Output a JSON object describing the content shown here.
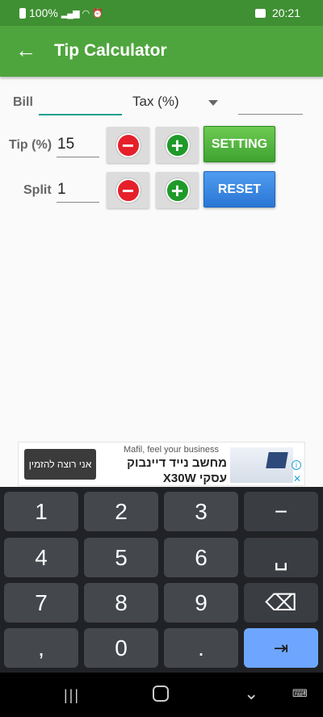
{
  "status_bar": {
    "battery": "100%",
    "time": "20:21"
  },
  "app_bar": {
    "title": "Tip Calculator",
    "back_icon": "arrow-left-icon"
  },
  "form": {
    "bill_label": "Bill",
    "bill_value": "",
    "tax_label": "Tax (%)",
    "tax_value": "",
    "tip_label": "Tip (%)",
    "tip_value": "15",
    "split_label": "Split",
    "split_value": "1",
    "setting_label": "SETTING",
    "reset_label": "RESET"
  },
  "ad": {
    "button_label": "אני רוצה להזמין",
    "subtitle": "Mafil, feel your business",
    "title_line1": "מחשב נייד דיינבוק",
    "title_line2": "X30W עסקי",
    "info_icon": "info-icon",
    "close_icon": "close-icon"
  },
  "keyboard": {
    "rows": [
      [
        "1",
        "2",
        "3",
        "−"
      ],
      [
        "4",
        "5",
        "6",
        "␣"
      ],
      [
        "7",
        "8",
        "9",
        "⌫"
      ],
      [
        ",",
        "0",
        ".",
        "⇥"
      ]
    ]
  },
  "nav_bar": {
    "recents_icon": "recents-icon",
    "home_icon": "home-icon",
    "back_icon": "chevron-down-icon",
    "keyboard_icon": "keyboard-icon"
  },
  "colors": {
    "status_bar": "#3f8f33",
    "app_bar": "#4fa53d",
    "setting_button": "#4fb03a",
    "reset_button": "#2f7fdb",
    "minus": "#e5202a",
    "plus": "#1f9a2a",
    "enter_key": "#6ea6ff"
  }
}
